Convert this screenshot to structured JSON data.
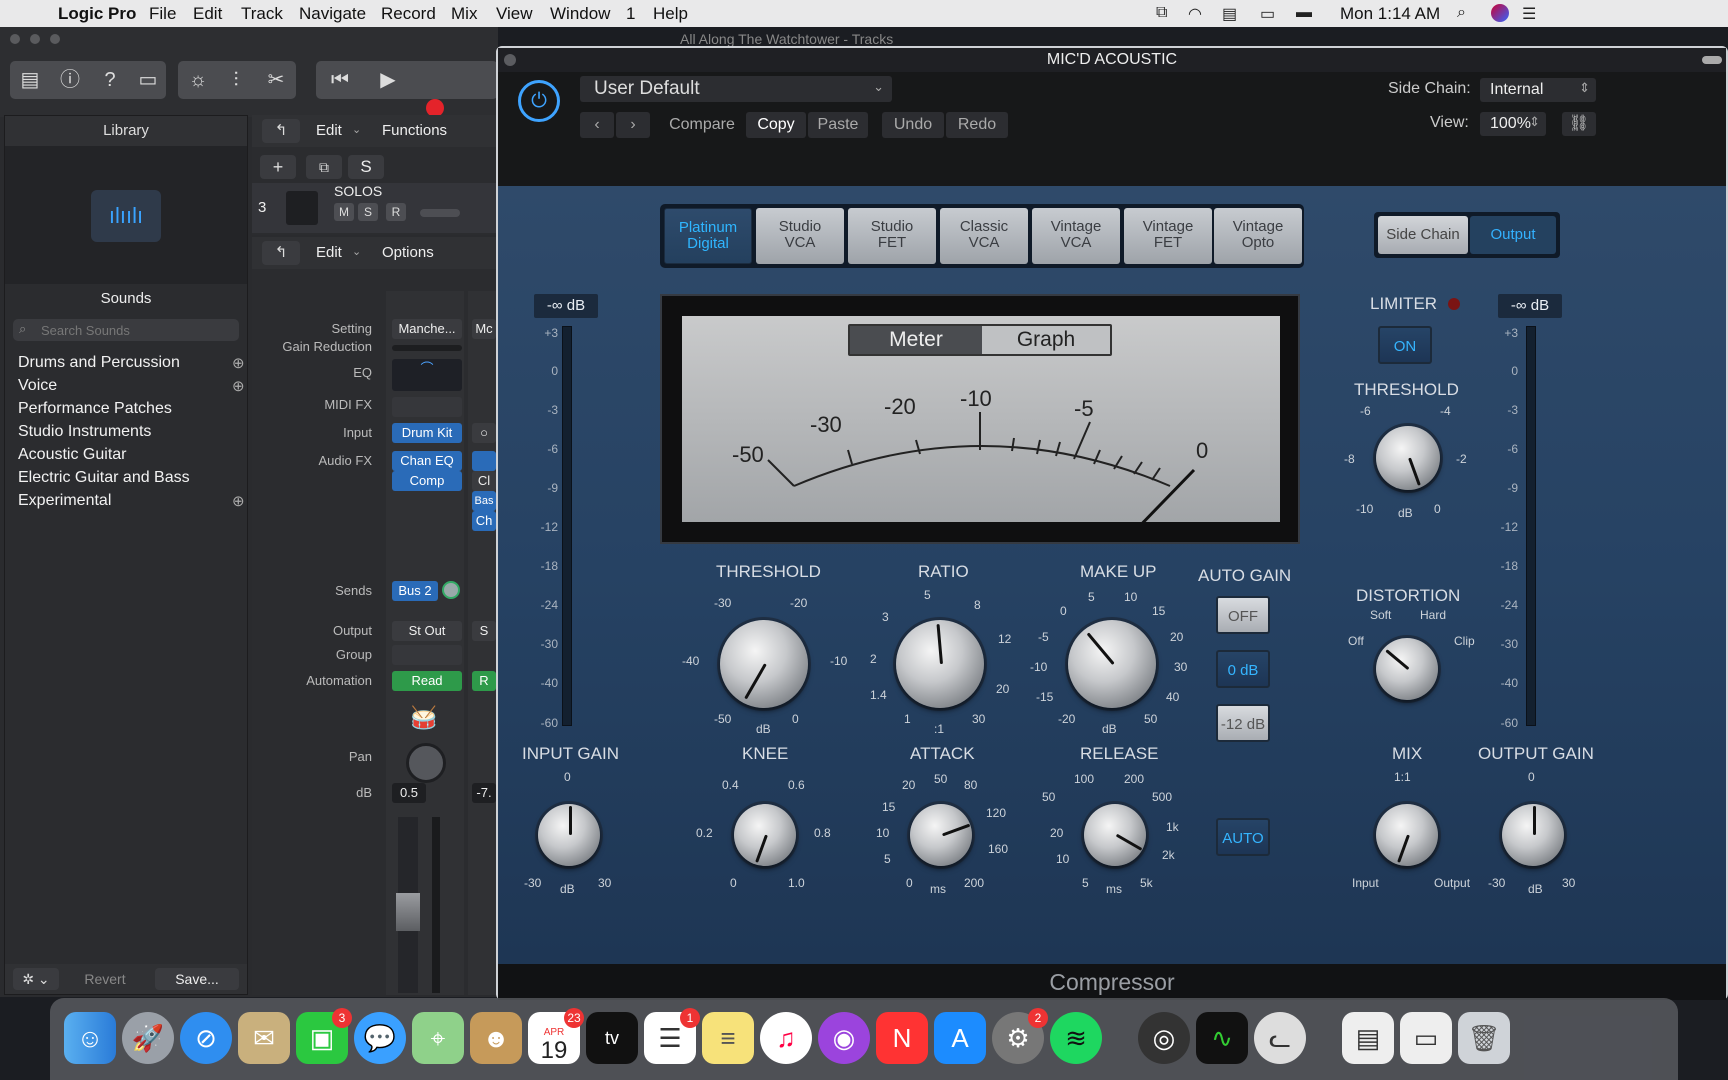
{
  "menubar": {
    "app": "Logic Pro",
    "items": [
      "File",
      "Edit",
      "Track",
      "Navigate",
      "Record",
      "Mix",
      "View",
      "Window",
      "1",
      "Help"
    ],
    "clock": "Mon 1:14 AM"
  },
  "logic": {
    "window_title": "All Along The Watchtower - Tracks",
    "library": {
      "header": "Library",
      "sounds_title": "Sounds",
      "search_placeholder": "Search Sounds",
      "items": [
        "Drums and Percussion",
        "Voice",
        "Performance Patches",
        "Studio Instruments",
        "Acoustic Guitar",
        "Electric Guitar and Bass",
        "Experimental"
      ],
      "revert": "Revert",
      "save": "Save..."
    },
    "tracks": {
      "edit": "Edit",
      "functions": "Functions",
      "track_number": "3",
      "track_name": "SOLOS",
      "m": "M",
      "s": "S",
      "r": "R",
      "s_button": "S"
    },
    "inspector": {
      "edit": "Edit",
      "options": "Options",
      "labels": {
        "setting": "Setting",
        "gain_reduction": "Gain Reduction",
        "eq": "EQ",
        "midi_fx": "MIDI FX",
        "input": "Input",
        "audio_fx": "Audio FX",
        "sends": "Sends",
        "output": "Output",
        "group": "Group",
        "automation": "Automation",
        "pan": "Pan",
        "db": "dB"
      },
      "setting_value": "Manche...",
      "setting_value2": "Mc",
      "input_value": "Drum Kit",
      "audiofx": [
        "Chan EQ",
        "Comp"
      ],
      "audiofx2": [
        "Cl",
        "Bas",
        "Ch"
      ],
      "send_value": "Bus 2",
      "output_value": "St Out",
      "output_value2": "S",
      "automation_value": "Read",
      "automation_value2": "R",
      "db_value": "0.5",
      "db_value2": "-7."
    }
  },
  "plugin": {
    "title": "MIC'D ACOUSTIC",
    "preset": "User Default",
    "compare": "Compare",
    "copy": "Copy",
    "paste": "Paste",
    "undo": "Undo",
    "redo": "Redo",
    "side_chain_label": "Side Chain:",
    "side_chain_value": "Internal",
    "view_label": "View:",
    "view_value": "100%",
    "models": [
      [
        "Platinum",
        "Digital"
      ],
      [
        "Studio",
        "VCA"
      ],
      [
        "Studio",
        "FET"
      ],
      [
        "Classic",
        "VCA"
      ],
      [
        "Vintage",
        "VCA"
      ],
      [
        "Vintage",
        "FET"
      ],
      [
        "Vintage",
        "Opto"
      ]
    ],
    "selected_model": "Platinum Digital",
    "side_chain_tab": "Side Chain",
    "output_tab": "Output",
    "meter_tab": "Meter",
    "graph_tab": "Graph",
    "vu_scale": [
      "-50",
      "-30",
      "-20",
      "-10",
      "-5",
      "0"
    ],
    "input_meter": "-∞ dB",
    "output_meter": "-∞ dB",
    "meter_scale": [
      "+3",
      "0",
      "-3",
      "-6",
      "-9",
      "-12",
      "-18",
      "-24",
      "-30",
      "-40",
      "-60"
    ],
    "limiter": "LIMITER",
    "limiter_on": "ON",
    "knobs": {
      "threshold": {
        "label": "THRESHOLD",
        "ticks": [
          "-30",
          "-20",
          "-40",
          "-10",
          "-50",
          "0"
        ],
        "unit": "dB"
      },
      "ratio": {
        "label": "RATIO",
        "ticks": [
          "5",
          "8",
          "3",
          "12",
          "2",
          "20",
          "1.4",
          "1",
          "30"
        ],
        "unit": ":1"
      },
      "makeup": {
        "label": "MAKE UP",
        "ticks": [
          "5",
          "10",
          "0",
          "15",
          "-5",
          "20",
          "-10",
          "30",
          "-15",
          "40",
          "-20",
          "50"
        ],
        "unit": "dB"
      },
      "knee": {
        "label": "KNEE",
        "ticks": [
          "0.4",
          "0.6",
          "0.2",
          "0.8",
          "0",
          "1.0"
        ]
      },
      "attack": {
        "label": "ATTACK",
        "ticks": [
          "50",
          "20",
          "80",
          "15",
          "120",
          "10",
          "160",
          "5",
          "0",
          "200"
        ],
        "unit": "ms"
      },
      "release": {
        "label": "RELEASE",
        "ticks": [
          "100",
          "200",
          "50",
          "500",
          "20",
          "1k",
          "10",
          "2k",
          "5",
          "5k"
        ],
        "unit": "ms"
      },
      "input_gain": {
        "label": "INPUT GAIN",
        "ticks": [
          "0",
          "-30",
          "30"
        ],
        "unit": "dB"
      },
      "lim_threshold": {
        "label": "THRESHOLD",
        "ticks": [
          "-6",
          "-4",
          "-8",
          "-2",
          "-10",
          "0"
        ],
        "unit": "dB"
      },
      "distortion": {
        "label": "DISTORTION",
        "ticks": [
          "Soft",
          "Hard",
          "Off",
          "Clip"
        ]
      },
      "mix": {
        "label": "MIX",
        "ticks": [
          "1:1",
          "Input",
          "Output"
        ]
      },
      "output_gain": {
        "label": "OUTPUT GAIN",
        "ticks": [
          "0",
          "-30",
          "30"
        ],
        "unit": "dB"
      }
    },
    "auto_gain": "AUTO GAIN",
    "auto_gain_off": "OFF",
    "auto_gain_0": "0 dB",
    "auto_gain_12": "-12 dB",
    "auto": "AUTO",
    "footer": "Compressor"
  },
  "dock": {
    "calendar_month": "APR",
    "calendar_day": "19",
    "facetime_badge": "3",
    "calendar_badge": "23",
    "reminders_badge": "1",
    "prefs_badge": "2",
    "tv": "tv"
  }
}
